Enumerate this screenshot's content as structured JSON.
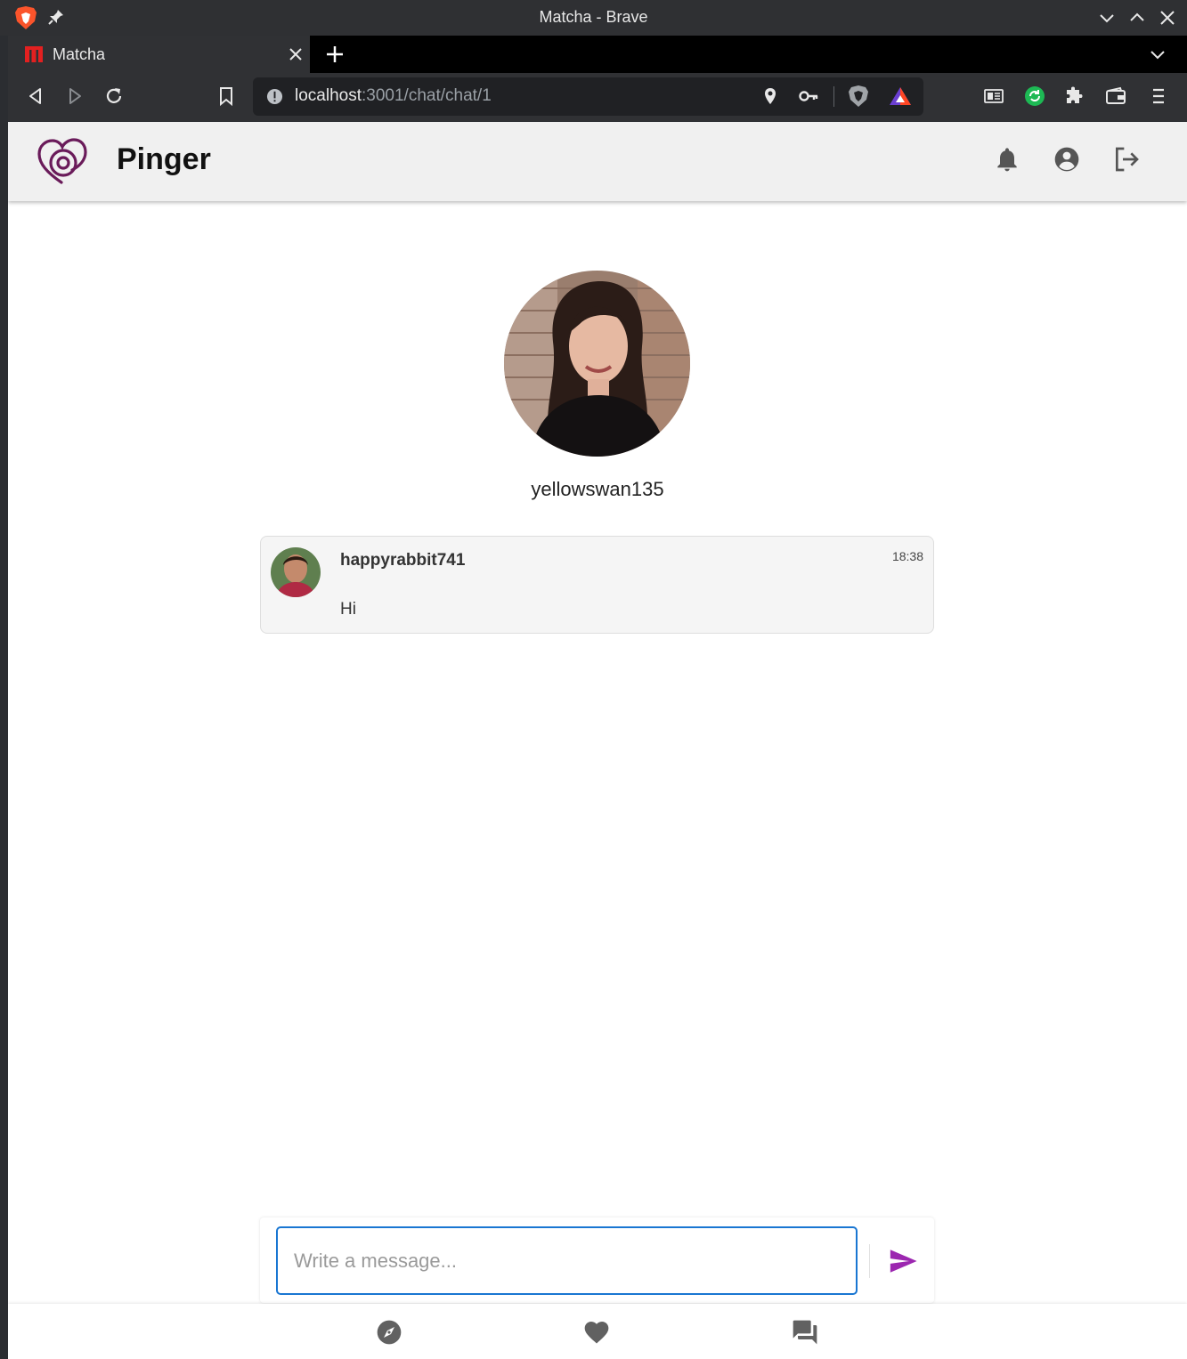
{
  "window": {
    "title": "Matcha - Brave"
  },
  "tab": {
    "title": "Matcha"
  },
  "address_bar": {
    "host": "localhost",
    "path": ":3001/chat/chat/1"
  },
  "app": {
    "brand": "Pinger"
  },
  "chat": {
    "partner_username": "yellowswan135",
    "messages": [
      {
        "author": "happyrabbit741",
        "time": "18:38",
        "text": "Hi"
      }
    ]
  },
  "composer": {
    "placeholder": "Write a message..."
  },
  "colors": {
    "accent_purple": "#9c27b0",
    "input_border": "#1976d2",
    "logo": "#6a1b5a"
  },
  "icons": {
    "header": [
      "bell-icon",
      "account-circle-icon",
      "logout-icon"
    ],
    "bottom_nav": [
      "compass-icon",
      "heart-icon",
      "forum-icon"
    ]
  }
}
